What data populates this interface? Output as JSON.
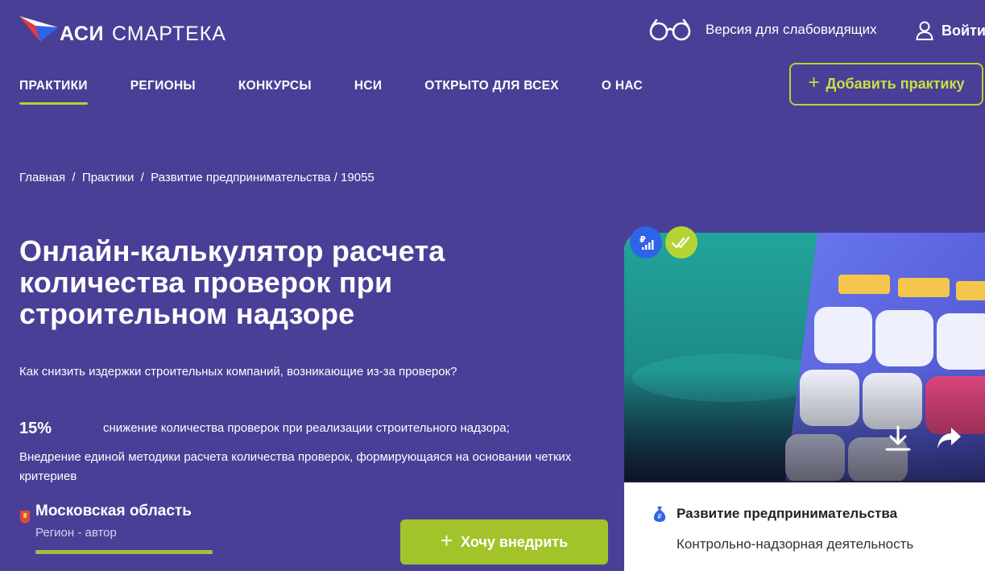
{
  "header": {
    "logo": {
      "primary": "АСИ",
      "secondary": "СМАРТЕКА"
    },
    "accessibility_label": "Версия для слабовидящих",
    "login_label": "Войти",
    "add_button_label": "Добавить практику"
  },
  "nav": {
    "items": [
      "ПРАКТИКИ",
      "РЕГИОНЫ",
      "КОНКУРСЫ",
      "НСИ",
      "ОТКРЫТО ДЛЯ ВСЕХ",
      "О НАС"
    ],
    "active_index": 0
  },
  "breadcrumb": {
    "items": [
      "Главная",
      "Практики",
      "Развитие предпринимательства"
    ],
    "current": "19055"
  },
  "practice": {
    "title_lines": [
      "Онлайн-калькулятор расчета",
      "количества проверок при",
      "строительном надзоре"
    ],
    "subtitle": "Как снизить издержки строительных компаний, возникающие из-за проверок?",
    "stat_value": "15%",
    "stat_text": "снижение количества проверок при реализации строительного надзора;",
    "description": "Внедрение единой методики расчета количества проверок, формирующаяся на основании четких критериев",
    "region_name": "Московская область",
    "region_role": "Регион - автор",
    "cta_label": "Хочу внедрить"
  },
  "card": {
    "category": "Развитие предпринимательства",
    "subcategory": "Контрольно-надзорная деятельность"
  },
  "colors": {
    "background": "#4a3f96",
    "accent": "#b5d433",
    "cta": "#a3c32a",
    "badge_blue": "#2f64e8"
  },
  "icons": [
    "logo-mark-icon",
    "glasses-icon",
    "user-icon",
    "plus-icon",
    "coat-of-arms-icon",
    "ruble-chart-icon",
    "double-check-icon",
    "download-icon",
    "share-icon",
    "money-bag-icon"
  ]
}
